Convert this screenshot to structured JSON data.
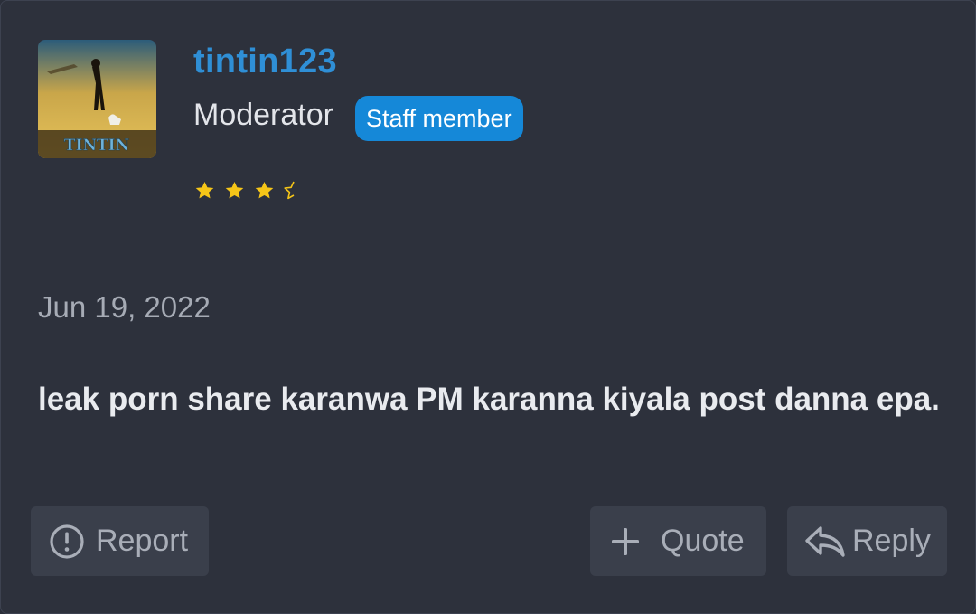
{
  "post": {
    "author": {
      "username": "tintin123",
      "role": "Moderator",
      "badge": "Staff member",
      "avatar_text": "TINTIN",
      "rating_stars": 3.5,
      "rating_max": 4
    },
    "date": "Jun 19, 2022",
    "message": "leak porn share karanwa PM karanna kiyala post danna epa.",
    "actions": {
      "report_label": "Report",
      "quote_label": "Quote",
      "reply_label": "Reply"
    }
  },
  "colors": {
    "background": "#2d313c",
    "username": "#2f8fd6",
    "badge": "#1588d8",
    "star": "#f5c518",
    "button_bg": "#3a3f4b"
  },
  "icons": {
    "report": "exclamation-circle-icon",
    "quote": "plus-icon",
    "reply": "reply-arrow-icon",
    "star": "star-icon"
  }
}
